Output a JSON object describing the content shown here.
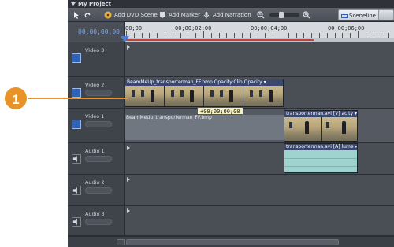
{
  "window": {
    "title": "My Project"
  },
  "toolbar": {
    "add_dvd_scene": "Add DVD Scene",
    "add_marker": "Add Marker",
    "add_narration": "Add Narration",
    "sceneline_tab": "Sceneline"
  },
  "timecode": "00;00;00;00",
  "ruler": {
    "labels": [
      "00;00",
      "00;00;02;00",
      "00;00;04;00",
      "00;00;06;00"
    ]
  },
  "tracks": {
    "video3": "Video 3",
    "video2": "Video 2",
    "video1": "Video 1",
    "audio1": "Audio 1",
    "audio2": "Audio 2",
    "audio3": "Audio 3"
  },
  "clips": {
    "v2_title": "BeamMeUp_transporterman_FF.bmp  Opacity:Clip Opacity ▾",
    "v1_title": "BeamMeUp_transporterman_FF.bmp",
    "v1_right_title": "transporterman.avi [V]  acity ▾",
    "a1_title": "transporterman.avi [A]  lume ▾"
  },
  "tooltip_timecode": "+00;00;00;00",
  "callout": {
    "number": "1"
  },
  "colors": {
    "accent": "#e8932a",
    "clip_header": "#3a4870",
    "timecode": "#7fa8e8"
  },
  "icons": [
    "selection-arrow-icon",
    "hand-tool-icon",
    "dvd-scene-icon",
    "marker-icon",
    "narration-icon",
    "zoom-out-icon",
    "zoom-in-icon",
    "video-track-icon",
    "audio-track-icon"
  ]
}
